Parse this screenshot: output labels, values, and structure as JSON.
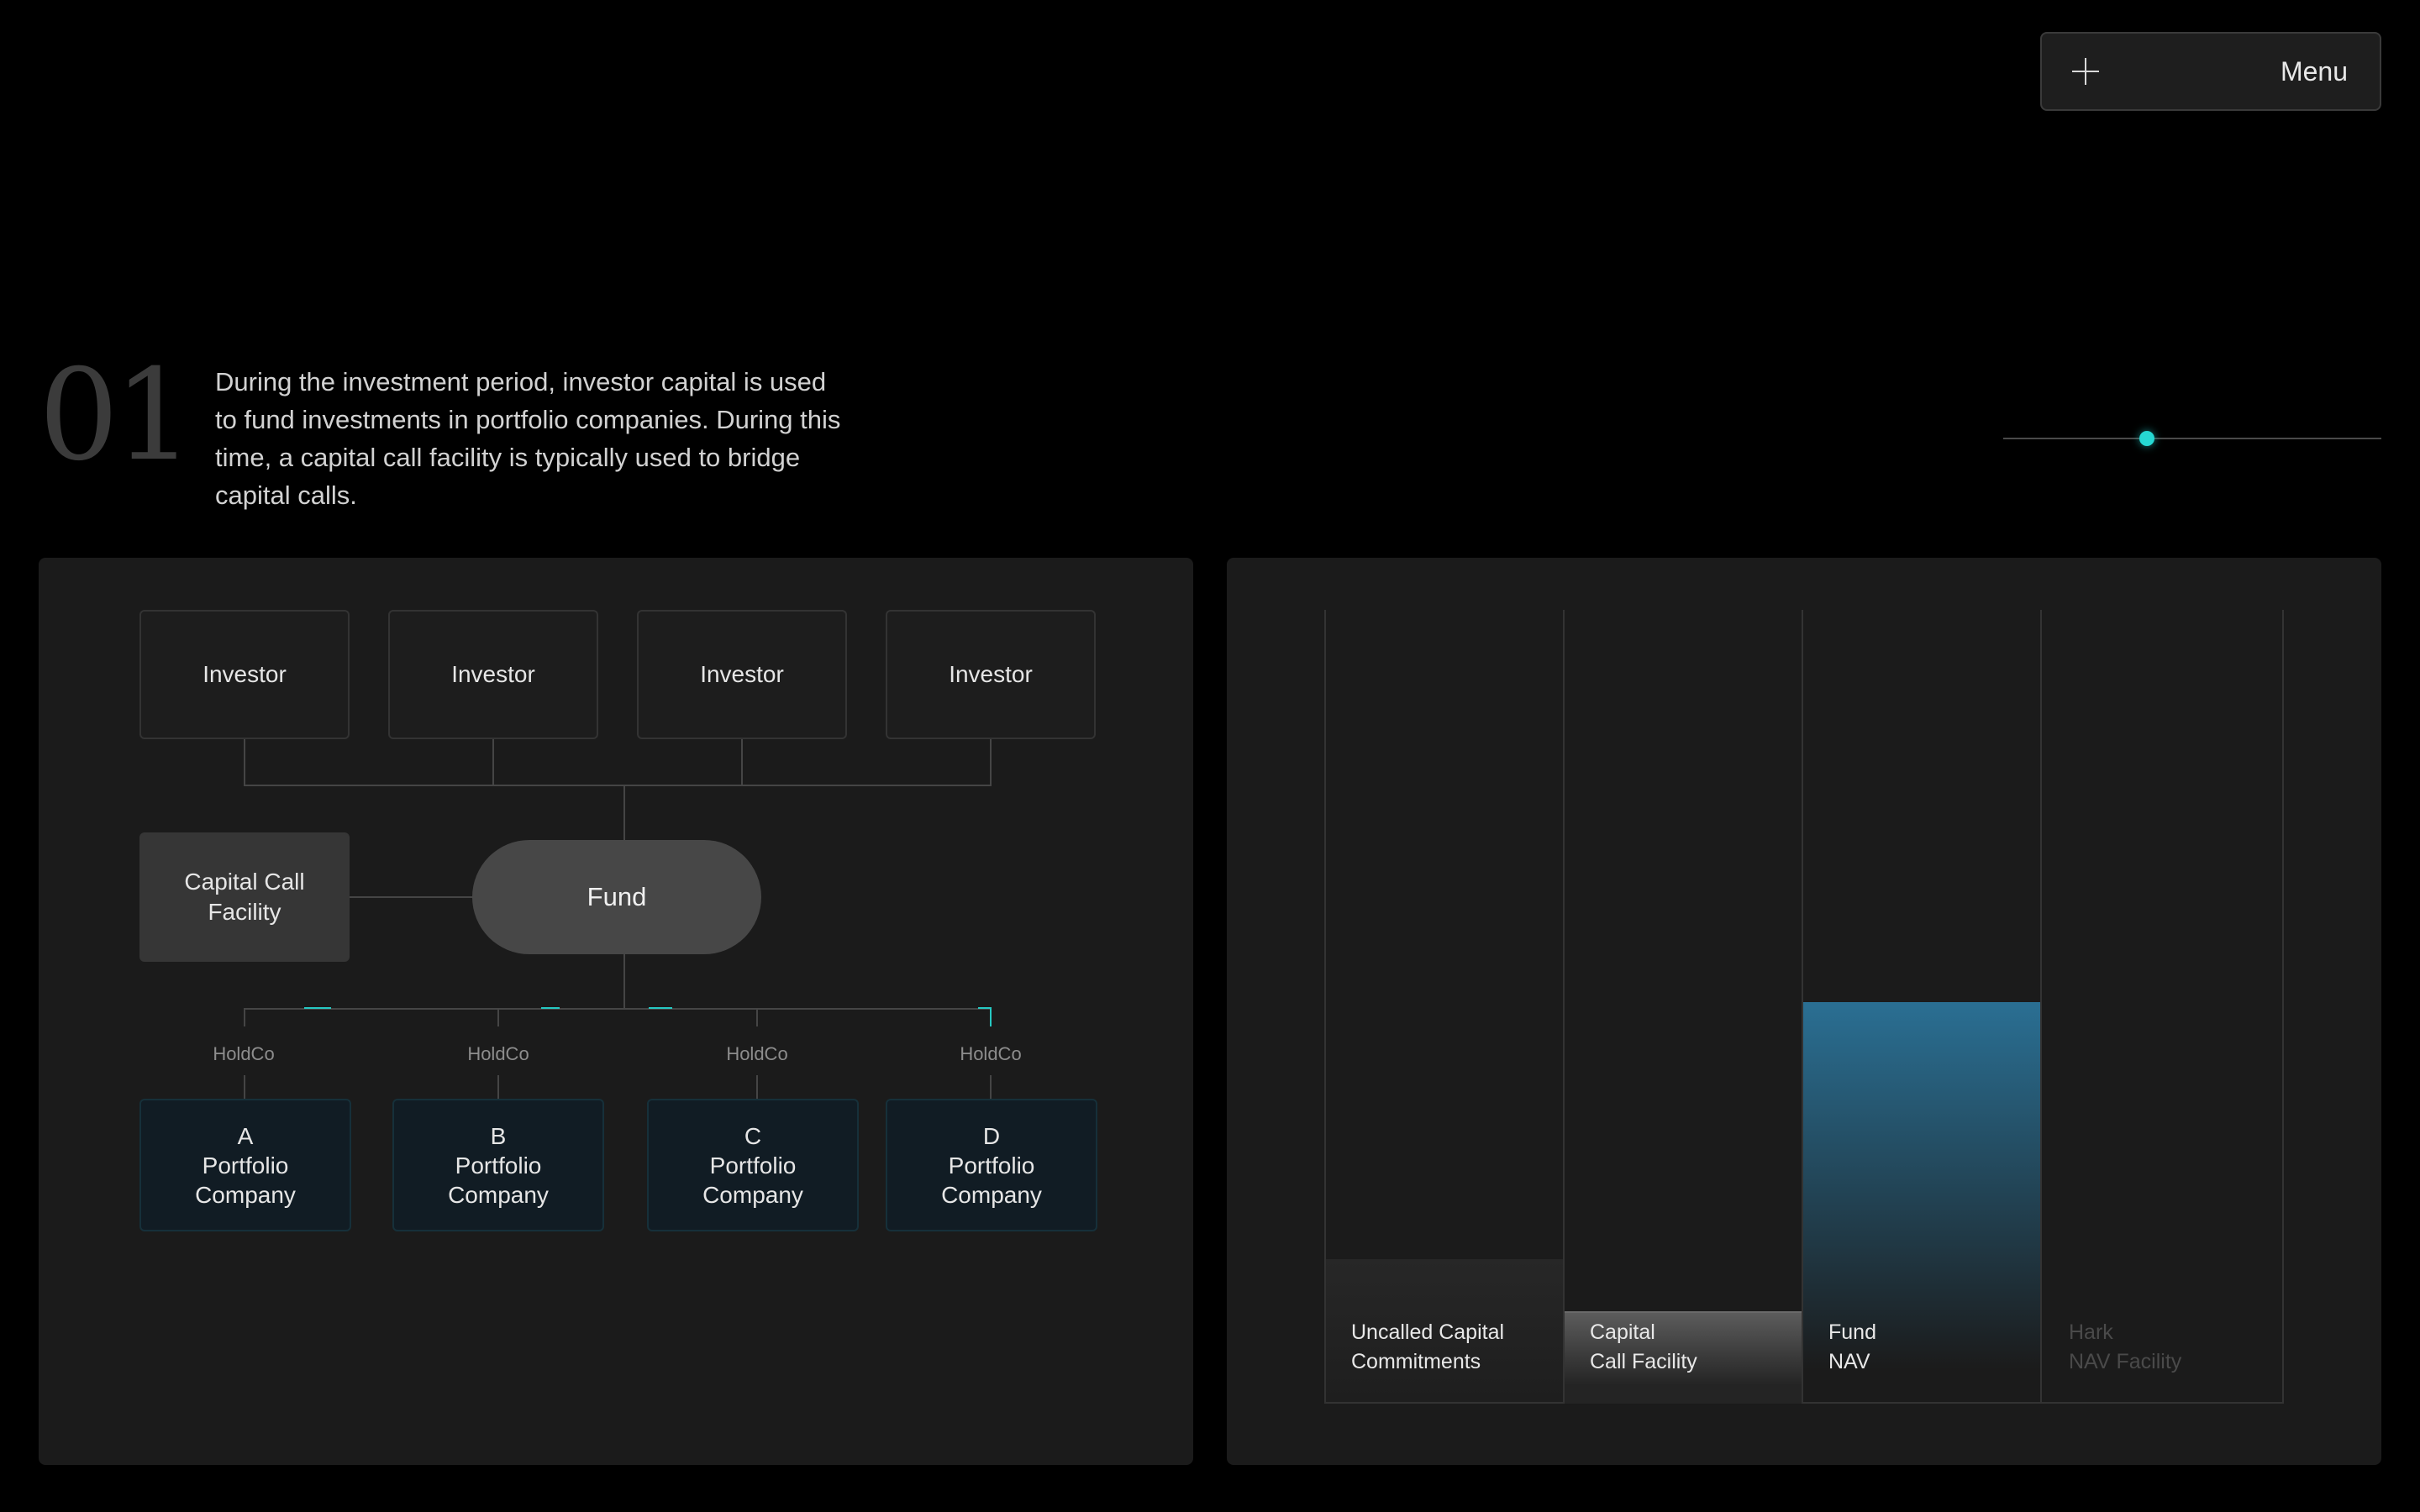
{
  "menu": {
    "label": "Menu"
  },
  "step": {
    "number": "01",
    "description": "During the investment period, investor capital is used to fund investments in portfolio companies. During this time, a capital call facility is typically used to bridge capital calls."
  },
  "progress": {
    "value": 0.38
  },
  "diagram": {
    "investors": [
      "Investor",
      "Investor",
      "Investor",
      "Investor"
    ],
    "facility": "Capital Call Facility",
    "fund": "Fund",
    "holdcos": [
      "HoldCo",
      "HoldCo",
      "HoldCo",
      "HoldCo"
    ],
    "companies": [
      {
        "letter": "A",
        "name": "Portfolio Company"
      },
      {
        "letter": "B",
        "name": "Portfolio Company"
      },
      {
        "letter": "C",
        "name": "Portfolio Company"
      },
      {
        "letter": "D",
        "name": "Portfolio Company"
      }
    ]
  },
  "colors": {
    "accent": "#26d9d3",
    "nav_bar_top": "#2a6f93",
    "nav_bar_bottom": "#1b1b1b"
  },
  "chart_data": {
    "type": "bar",
    "categories": [
      "Uncalled Capital Commitments",
      "Capital Call Facility",
      "Fund NAV",
      "Hark NAV Facility"
    ],
    "values": [
      0.18,
      0.115,
      0.505,
      0
    ],
    "ylim": [
      0,
      1
    ],
    "grid": true,
    "labels": [
      {
        "line1": "Uncalled Capital",
        "line2": "Commitments"
      },
      {
        "line1": "Capital",
        "line2": "Call Facility"
      },
      {
        "line1": "Fund",
        "line2": "NAV"
      },
      {
        "line1": "Hark",
        "line2": "NAV Facility"
      }
    ]
  }
}
